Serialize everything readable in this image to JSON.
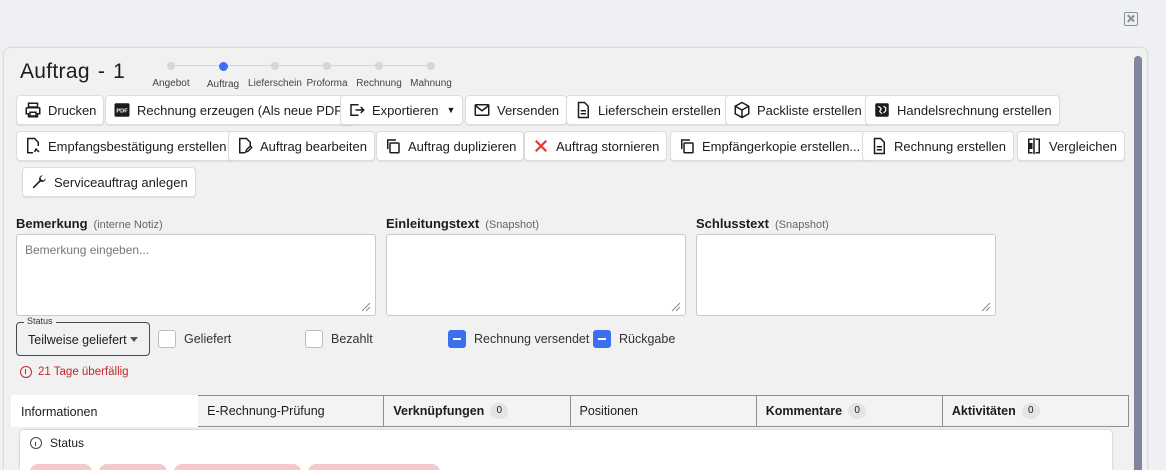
{
  "page": {
    "title_word": "Auftrag",
    "title_sep": "-",
    "title_number": "1"
  },
  "stepper": {
    "active_index": 1,
    "steps": [
      "Angebot",
      "Auftrag",
      "Lieferschein",
      "Proforma",
      "Rechnung",
      "Mahnung"
    ]
  },
  "toolbar": {
    "print": "Drucken",
    "invoice_pdf": "Rechnung erzeugen (Als neue PDF)",
    "export": "Exportieren",
    "send": "Versenden",
    "delivery_note": "Lieferschein erstellen",
    "packing_list": "Packliste erstellen",
    "commercial_invoice": "Handelsrechnung erstellen",
    "receipt_confirmation": "Empfangsbestätigung erstellen",
    "edit_order": "Auftrag bearbeiten",
    "duplicate_order": "Auftrag duplizieren",
    "cancel_order": "Auftrag stornieren",
    "recipient_copy": "Empfängerkopie erstellen...",
    "create_invoice": "Rechnung erstellen",
    "compare": "Vergleichen",
    "service_order": "Serviceauftrag anlegen"
  },
  "fields": {
    "remark": {
      "label": "Bemerkung",
      "hint": "(interne Notiz)",
      "placeholder": "Bemerkung eingeben..."
    },
    "intro": {
      "label": "Einleitungstext",
      "hint": "(Snapshot)"
    },
    "closing": {
      "label": "Schlusstext",
      "hint": "(Snapshot)"
    }
  },
  "status": {
    "legend": "Status",
    "value": "Teilweise geliefert"
  },
  "checkboxes": {
    "delivered": {
      "label": "Geliefert",
      "checked": false
    },
    "paid": {
      "label": "Bezahlt",
      "checked": false
    },
    "invoice_sent": {
      "label": "Rechnung versendet",
      "checked": true
    },
    "return": {
      "label": "Rückgabe",
      "checked": true
    }
  },
  "overdue": "21 Tage überfällig",
  "tabs": [
    {
      "label": "Informationen",
      "count": ""
    },
    {
      "label": "E-Rechnung-Prüfung",
      "count": ""
    },
    {
      "label": "Verknüpfungen",
      "count": "0"
    },
    {
      "label": "Positionen",
      "count": ""
    },
    {
      "label": "Kommentare",
      "count": "0"
    },
    {
      "label": "Aktivitäten",
      "count": "0"
    }
  ],
  "info_card": {
    "title": "Status"
  },
  "colors": {
    "accent": "#3c6ef0",
    "danger": "#c62828",
    "danger_soft": "#f5c9c9"
  },
  "icons": {
    "print": "printer-icon",
    "pdf": "pdf-icon",
    "export": "export-icon",
    "send": "mail-icon",
    "delivery_note": "document-icon",
    "packing_list": "package-icon",
    "commercial_invoice": "globe-icon",
    "receipt": "document-edit-icon",
    "edit": "edit-icon",
    "duplicate": "copy-icon",
    "cancel": "cross-icon",
    "recipient_copy": "copy-icon",
    "invoice": "document-icon",
    "compare": "compare-icon",
    "service": "wrench-icon"
  }
}
